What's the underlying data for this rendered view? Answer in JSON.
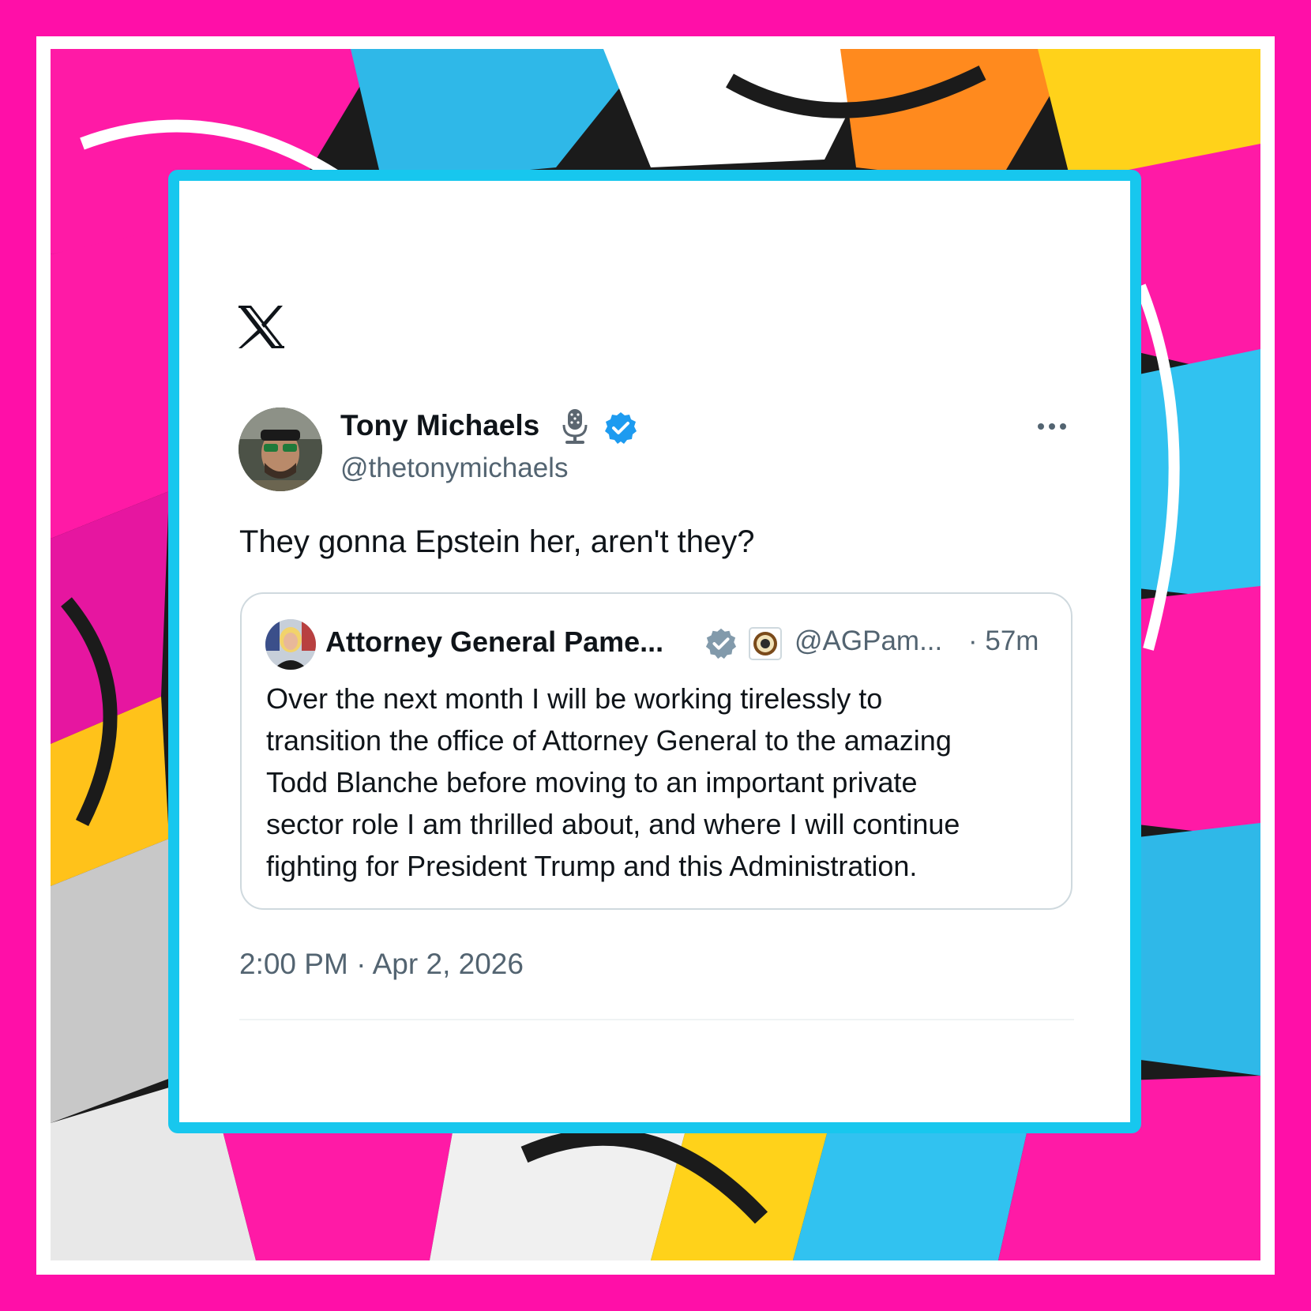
{
  "colors": {
    "outer_border": "#ff0fa8",
    "card_border": "#17c7ee",
    "verified_blue": "#1d9bf0",
    "verified_gray": "#829aab",
    "text_primary": "#0f1419",
    "text_secondary": "#536471"
  },
  "platform": {
    "logo_icon": "x-logo-icon"
  },
  "tweet": {
    "author": {
      "display_name": "Tony Michaels",
      "handle": "@thetonymichaels",
      "badges": [
        "microphone-icon",
        "verified-badge-icon"
      ]
    },
    "text": "They gonna Epstein her, aren't they?",
    "timestamp": "2:00 PM · Apr 2, 2026",
    "more_icon": "more-options-icon"
  },
  "quoted_tweet": {
    "author": {
      "display_name": "Attorney General Pame...",
      "handle": "@AGPam...",
      "badges": [
        "verified-gray-badge-icon",
        "doj-seal-icon"
      ]
    },
    "time": "· 57m",
    "body_lines": [
      "Over the next month I will be working tirelessly to",
      "transition the office of Attorney General to the amazing",
      "Todd Blanche before moving to an important private",
      "sector role I am thrilled about, and where I will continue",
      "fighting for President Trump and this Administration."
    ]
  }
}
